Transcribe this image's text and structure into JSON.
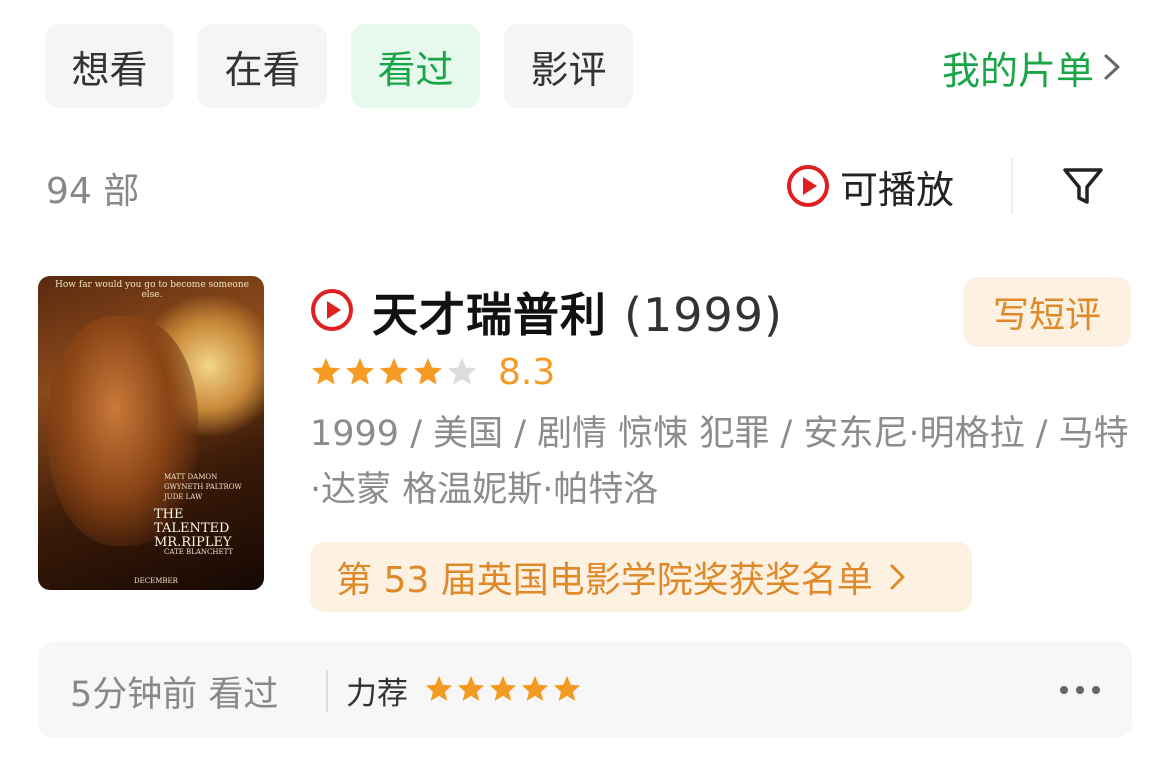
{
  "tabs": [
    {
      "label": "想看",
      "active": false
    },
    {
      "label": "在看",
      "active": false
    },
    {
      "label": "看过",
      "active": true
    },
    {
      "label": "影评",
      "active": false
    }
  ],
  "my_list": {
    "label": "我的片单",
    "icon": "chevron-right-icon"
  },
  "count_label": "94 部",
  "playable": {
    "label": "可播放",
    "icon": "play-circle-icon"
  },
  "filter": {
    "icon": "filter-icon"
  },
  "movie": {
    "title": "天才瑞普利",
    "year": "(1999)",
    "rating": "8.3",
    "stars": 4,
    "meta": "1999 / 美国 / 剧情 惊悚 犯罪 / 安东尼·明格拉 / 马特·达蒙 格温妮斯·帕特洛",
    "write_review": "写短评",
    "award": "第 53 届英国电影学院奖获奖名单",
    "poster": {
      "tagline": "How far would you go to become someone else.",
      "credits": "MATT DAMON\nGWYNETH PALTROW\nJUDE LAW",
      "title": "THE\nTALENTED\nMR.RIPLEY",
      "cate": "CATE BLANCHETT",
      "month": "DECEMBER"
    }
  },
  "footer": {
    "time_label": "5分钟前 看过",
    "recommend_label": "力荐",
    "stars": 5,
    "more_icon": "more-dots-icon"
  },
  "colors": {
    "green": "#1aa549",
    "orange": "#f59a23",
    "play_red": "#e02020",
    "star_gray": "#dcdcdc"
  }
}
